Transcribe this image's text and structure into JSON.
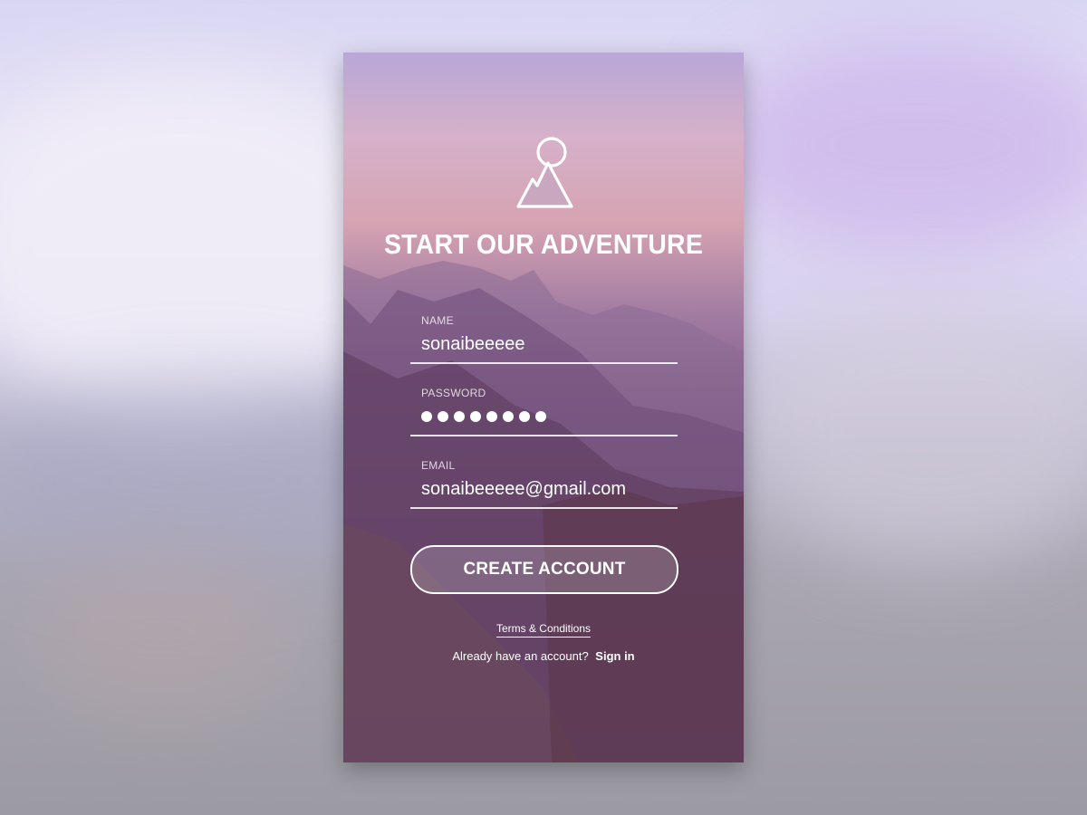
{
  "header": {
    "title": "START OUR ADVENTURE"
  },
  "form": {
    "name": {
      "label": "NAME",
      "value": "sonaibeeeee"
    },
    "password": {
      "label": "PASSWORD",
      "masked_length": 8
    },
    "email": {
      "label": "EMAIL",
      "value": "sonaibeeeee@gmail.com"
    }
  },
  "actions": {
    "create_account_label": "CREATE ACCOUNT",
    "terms_label": "Terms & Conditions",
    "signin_prompt": "Already have an account?",
    "signin_label": "Sign in"
  },
  "icons": {
    "logo": "mountain-sun-icon"
  },
  "colors": {
    "accent": "#ffffff",
    "overlay_top": "#d6b1c9",
    "overlay_bottom": "#4a2a40"
  }
}
